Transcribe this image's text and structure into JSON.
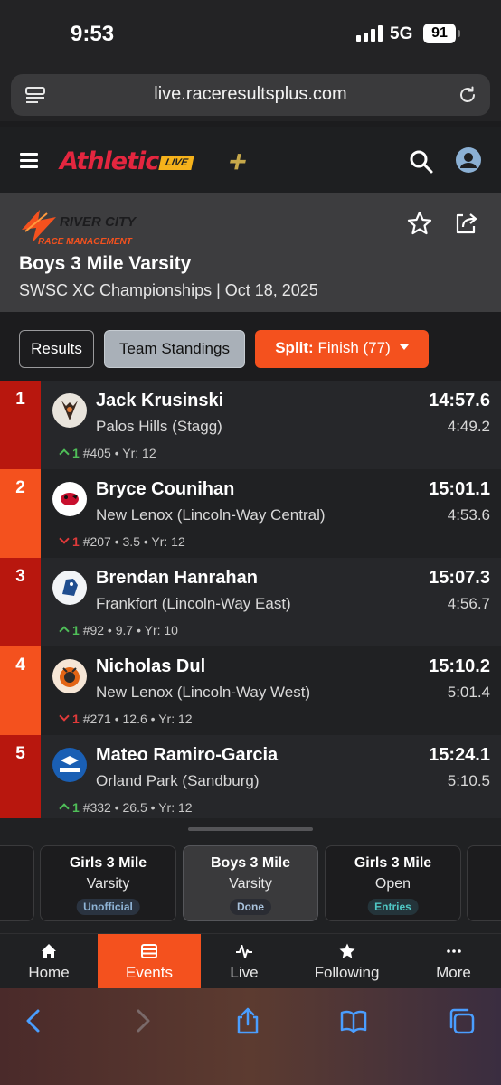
{
  "status_bar": {
    "time": "9:53",
    "network": "5G",
    "battery": "91"
  },
  "browser": {
    "url": "live.raceresultsplus.com"
  },
  "app": {
    "logo_main": "Athletic",
    "logo_live": "LIVE",
    "logo_plus": "+"
  },
  "event": {
    "org_logo_text_1": "RIVER CITY",
    "org_logo_text_2": "RACE MANAGEMENT",
    "title": "Boys 3 Mile Varsity",
    "subtitle": "SWSC XC Championships | Oct 18, 2025"
  },
  "tabs": {
    "results": "Results",
    "team_standings": "Team Standings",
    "split_label": "Split:",
    "split_value": "Finish (77)"
  },
  "results": [
    {
      "place": "1",
      "name": "Jack Krusinski",
      "school": "Palos Hills (Stagg)",
      "time": "14:57.6",
      "split": "4:49.2",
      "change_dir": "up",
      "change": "1",
      "meta": "#405 • Yr: 12",
      "logo_color": "#e9e4dc",
      "place_color": "#b8170e"
    },
    {
      "place": "2",
      "name": "Bryce Counihan",
      "school": "New Lenox (Lincoln-Way Central)",
      "time": "15:01.1",
      "split": "4:53.6",
      "change_dir": "down",
      "change": "1",
      "meta": "#207 • 3.5 • Yr: 12",
      "logo_color": "#ffffff",
      "place_color": "#f4511e"
    },
    {
      "place": "3",
      "name": "Brendan Hanrahan",
      "school": "Frankfort (Lincoln-Way East)",
      "time": "15:07.3",
      "split": "4:56.7",
      "change_dir": "up",
      "change": "1",
      "meta": "#92 • 9.7 • Yr: 10",
      "logo_color": "#f2f4f7",
      "place_color": "#b8170e"
    },
    {
      "place": "4",
      "name": "Nicholas Dul",
      "school": "New Lenox (Lincoln-Way West)",
      "time": "15:10.2",
      "split": "5:01.4",
      "change_dir": "down",
      "change": "1",
      "meta": "#271 • 12.6 • Yr: 12",
      "logo_color": "#f6e6d6",
      "place_color": "#f4511e"
    },
    {
      "place": "5",
      "name": "Mateo Ramiro-Garcia",
      "school": "Orland Park (Sandburg)",
      "time": "15:24.1",
      "split": "5:10.5",
      "change_dir": "up",
      "change": "1",
      "meta": "#332 • 26.5 • Yr: 12",
      "logo_color": "#1a5fb4",
      "place_color": "#b8170e"
    }
  ],
  "event_switcher": [
    {
      "line1": "Girls 3 Mile",
      "line2": "Varsity",
      "badge": "Unofficial"
    },
    {
      "line1": "Boys 3 Mile",
      "line2": "Varsity",
      "badge": "Done"
    },
    {
      "line1": "Girls 3 Mile",
      "line2": "Open",
      "badge": "Entries"
    }
  ],
  "bottom_nav": [
    {
      "label": "Home",
      "icon": "home-icon"
    },
    {
      "label": "Events",
      "icon": "events-icon"
    },
    {
      "label": "Live",
      "icon": "pulse-icon"
    },
    {
      "label": "Following",
      "icon": "star-icon"
    },
    {
      "label": "More",
      "icon": "more-icon"
    }
  ],
  "colors": {
    "accent": "#f4511e",
    "place_dark": "#b8170e",
    "up": "#4fbf58",
    "down": "#e03a3a"
  }
}
